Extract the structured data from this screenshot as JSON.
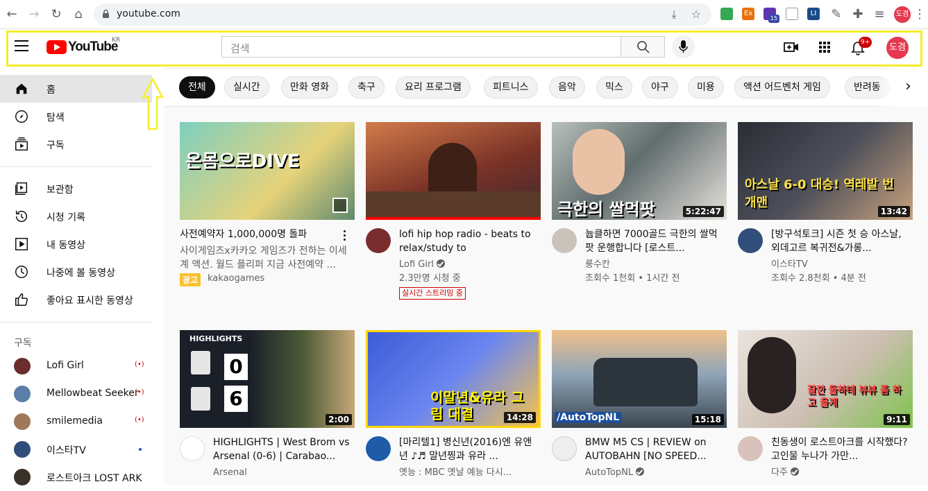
{
  "browser": {
    "url": "youtube.com",
    "profile_initials": "도겸",
    "ext_badge": "15",
    "ext_ex": "Ex",
    "ext_li": "LI"
  },
  "header": {
    "country_code": "KR",
    "logo_text": "YouTube",
    "search_placeholder": "검색",
    "notification_count": "9+",
    "avatar_initials": "도겸"
  },
  "sidebar": {
    "primary": [
      {
        "label": "홈",
        "icon": "home-icon",
        "active": true
      },
      {
        "label": "탐색",
        "icon": "explore-icon"
      },
      {
        "label": "구독",
        "icon": "subscriptions-icon"
      }
    ],
    "library": [
      {
        "label": "보관함",
        "icon": "library-icon"
      },
      {
        "label": "시청 기록",
        "icon": "history-icon"
      },
      {
        "label": "내 동영상",
        "icon": "your-videos-icon"
      },
      {
        "label": "나중에 볼 동영상",
        "icon": "watch-later-icon"
      },
      {
        "label": "좋아요 표시한 동영상",
        "icon": "liked-icon"
      }
    ],
    "subscriptions_heading": "구독",
    "subscriptions": [
      {
        "label": "Lofi Girl",
        "status": "live"
      },
      {
        "label": "Mellowbeat Seeker",
        "status": "live"
      },
      {
        "label": "smilemedia",
        "status": "live"
      },
      {
        "label": "이스타TV",
        "status": "new"
      },
      {
        "label": "로스트아크 LOST ARK",
        "status": ""
      }
    ]
  },
  "chips": [
    "전체",
    "실시간",
    "만화 영화",
    "축구",
    "요리 프로그램",
    "피트니스",
    "음악",
    "믹스",
    "야구",
    "미용",
    "액션 어드벤처 게임",
    "반려동"
  ],
  "videos": [
    {
      "title": "사전예약자 1,000,000명 돌파",
      "description": "사이게임즈x카카오 게임즈가 전하는 이세계 액션. 월드 플리퍼 지금 사전예약 ...",
      "ad_label": "광고",
      "channel": "kakaogames",
      "thumb_text": "온몸으로DIVE",
      "thumb_color": "#6fb7a8"
    },
    {
      "title": "lofi hip hop radio - beats to relax/study to",
      "channel": "Lofi Girl",
      "views": "2.3만명 시청 중",
      "live_label": "실시간 스트리밍 중",
      "thumb_color": "#8a3b2e"
    },
    {
      "title": "늅클하면 7000골드 극한의 쌀먹팟 운행합니다 [로스트...",
      "channel": "룽수칸",
      "views": "조회수 1천회 • 1시간 전",
      "duration": "5:22:47",
      "thumb_text": "극한의 쌀먹팟",
      "thumb_color": "#5e6b70"
    },
    {
      "title": "[방구석토크] 시즌 첫 승 아스날, 외데고르 복귀전&가롱...",
      "channel": "이스타TV",
      "views": "조회수 2.8천회 • 4분 전",
      "duration": "13:42",
      "thumb_text": "아스날 6-0 대승! 역레발 번개맨",
      "thumb_color": "#2b2d35"
    },
    {
      "title": "HIGHLIGHTS | West Brom vs Arsenal (0-6) | Carabao...",
      "channel": "Arsenal",
      "views": "",
      "duration": "2:00",
      "thumb_text": "HIGHLIGHTS",
      "score_left": "0",
      "score_right": "6",
      "thumb_color": "#1b1f27"
    },
    {
      "title": "[마리텔1] 병신년(2016)엔 유앤년 ♪♬ 말년찡과 유라 ...",
      "channel": "옛능 : MBC 옛날 예능 다시...",
      "views": "",
      "duration": "14:28",
      "thumb_text": "이말년&유라 그림 대결",
      "thumb_color": "#3c5bd6"
    },
    {
      "title": "BMW M5 CS | REVIEW on AUTOBAHN [NO SPEED...",
      "channel": "AutoTopNL",
      "views": "",
      "duration": "15:18",
      "thumb_text": "/AutoTopNL",
      "thumb_color": "#8fa5b8"
    },
    {
      "title": "친동생이 로스트아크를 시작했다? 고인물 누나가 가만...",
      "channel": "다주",
      "views": "",
      "duration": "9:11",
      "thumb_text": "잘깐 돌하테 뷰뷰 좀 하고 올게",
      "thumb_color": "#d9d2cc"
    }
  ]
}
